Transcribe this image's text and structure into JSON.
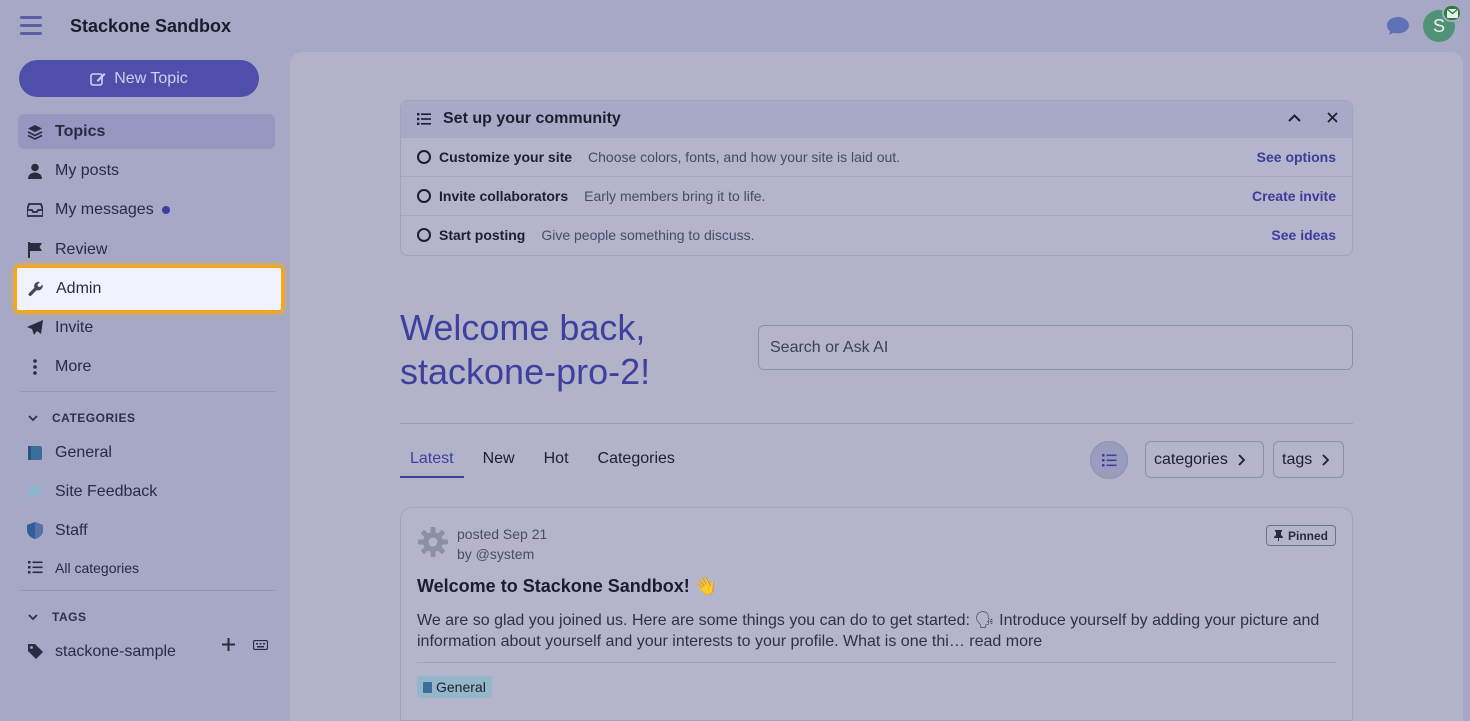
{
  "header": {
    "site_title": "Stackone Sandbox",
    "avatar_letter": "S"
  },
  "sidebar": {
    "new_topic_label": "New Topic",
    "nav": [
      {
        "label": "Topics",
        "icon": "layers-icon",
        "active": true
      },
      {
        "label": "My posts",
        "icon": "user-icon"
      },
      {
        "label": "My messages",
        "icon": "inbox-icon",
        "unread": true
      },
      {
        "label": "Review",
        "icon": "flag-icon"
      },
      {
        "label": "Admin",
        "icon": "wrench-icon",
        "highlighted": true
      },
      {
        "label": "Invite",
        "icon": "paper-plane-icon"
      },
      {
        "label": "More",
        "icon": "vertical-ellipsis-icon"
      }
    ],
    "categories_heading": "CATEGORIES",
    "categories": [
      {
        "label": "General",
        "color": "#3a6d9e"
      },
      {
        "label": "Site Feedback",
        "color": "#8fb3cc"
      },
      {
        "label": "Staff",
        "color": "#2f5f9a"
      }
    ],
    "all_categories_label": "All categories",
    "tags_heading": "TAGS",
    "tags": [
      {
        "label": "stackone-sample"
      }
    ]
  },
  "setup": {
    "title": "Set up your community",
    "rows": [
      {
        "title": "Customize your site",
        "desc": "Choose colors, fonts, and how your site is laid out.",
        "link": "See options"
      },
      {
        "title": "Invite collaborators",
        "desc": "Early members bring it to life.",
        "link": "Create invite"
      },
      {
        "title": "Start posting",
        "desc": "Give people something to discuss.",
        "link": "See ideas"
      }
    ]
  },
  "welcome": {
    "line1": "Welcome back,",
    "line2": "stackone-pro-2!"
  },
  "search": {
    "placeholder": "Search or Ask AI"
  },
  "tabs": [
    {
      "label": "Latest",
      "active": true
    },
    {
      "label": "New"
    },
    {
      "label": "Hot"
    },
    {
      "label": "Categories"
    }
  ],
  "filters": {
    "categories_label": "categories",
    "tags_label": "tags"
  },
  "topic": {
    "posted": "posted Sep 21",
    "by": "by @system",
    "pinned_label": "Pinned",
    "title": "Welcome to Stackone Sandbox! 👋",
    "excerpt": "We are so glad you joined us. Here are some things you can do to get started: 🗣 Introduce yourself by adding your picture and information about yourself and your interests to your profile. What is one thi… read more",
    "category": "General"
  },
  "colors": {
    "accent": "#3e40a0",
    "highlight_border": "#f5a817",
    "avatar": "#4f9276"
  }
}
